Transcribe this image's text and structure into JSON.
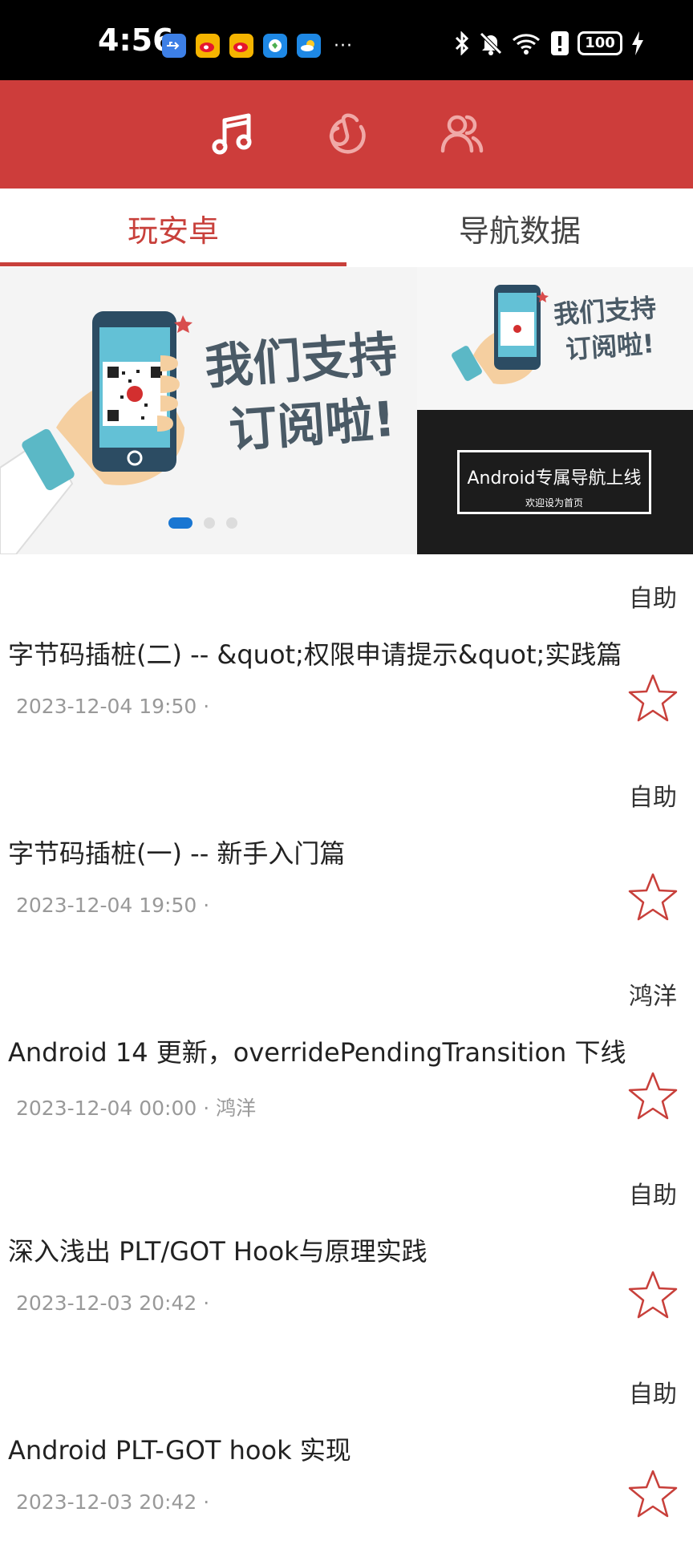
{
  "status_bar": {
    "time": "4:56",
    "more": "···",
    "battery": "100"
  },
  "tabs": [
    {
      "label": "玩安卓"
    },
    {
      "label": "导航数据"
    }
  ],
  "banner": {
    "slide_main_text_line1": "我们支持",
    "slide_main_text_line2": "订阅啦!",
    "side_text_line1": "我们支持",
    "side_text_line2": "订阅啦!",
    "nav_title": "Android专属导航上线",
    "nav_subtitle": "欢迎设为首页"
  },
  "articles": [
    {
      "author": "自助",
      "title": "字节码插桩(二) -- &quot;权限申请提示&quot;实践篇",
      "meta": "2023-12-04 19:50 ·"
    },
    {
      "author": "自助",
      "title": "字节码插桩(一) -- 新手入门篇",
      "meta": "2023-12-04 19:50 ·"
    },
    {
      "author": "鸿洋",
      "title": "Android 14 更新，overridePendingTransition 下线",
      "meta": "2023-12-04 00:00 · 鸿洋"
    },
    {
      "author": "自助",
      "title": "深入浅出 PLT/GOT Hook与原理实践",
      "meta": "2023-12-03 20:42 ·"
    },
    {
      "author": "自助",
      "title": "Android PLT-GOT hook 实现",
      "meta": "2023-12-03 20:42 ·"
    }
  ],
  "colors": {
    "primary_red": "#cd3d3b",
    "tab_active": "#c8403b",
    "indicator_blue": "#1976d2"
  }
}
